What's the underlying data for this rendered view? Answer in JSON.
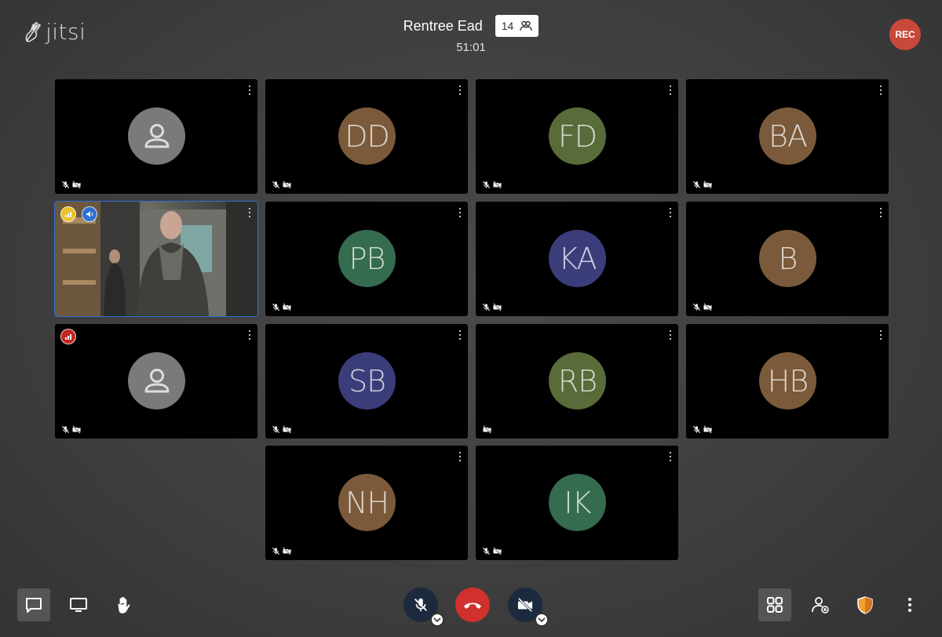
{
  "app": {
    "logo_text": "jitsi"
  },
  "header": {
    "title": "Rentree Ead",
    "participant_count": "14",
    "timer": "51:01"
  },
  "recording": {
    "label": "REC",
    "color": "#c8483a"
  },
  "tiles": [
    {
      "initials": "",
      "color": "#7a7a7a",
      "generic": true
    },
    {
      "initials": "DD",
      "color": "#7a5a3a"
    },
    {
      "initials": "FD",
      "color": "#5a6b3a"
    },
    {
      "initials": "BA",
      "color": "#7a5a3a"
    },
    {
      "initials": "",
      "video": true,
      "active": true
    },
    {
      "initials": "PB",
      "color": "#356b4f"
    },
    {
      "initials": "KA",
      "color": "#3b3d7a"
    },
    {
      "initials": "B",
      "color": "#7a5a3a"
    },
    {
      "initials": "",
      "color": "#7a7a7a",
      "generic": true
    },
    {
      "initials": "SB",
      "color": "#3b3d7a"
    },
    {
      "initials": "RB",
      "color": "#5a6b3a"
    },
    {
      "initials": "HB",
      "color": "#7a5a3a"
    },
    {
      "initials": "NH",
      "color": "#7a5a3a"
    },
    {
      "initials": "IK",
      "color": "#356b4f"
    }
  ],
  "icons": {
    "chat": "chat-icon",
    "screenshare": "screen-share-icon",
    "raise_hand": "raise-hand-icon",
    "mic": "mic-muted-icon",
    "hangup": "hangup-icon",
    "camera": "camera-off-icon",
    "tile_view": "tile-view-icon",
    "invite": "invite-icon",
    "security": "shield-icon",
    "more": "more-icon"
  },
  "colors": {
    "accent": "#2f6fd1",
    "hangup": "#d0312d",
    "security": "#f0a030"
  }
}
